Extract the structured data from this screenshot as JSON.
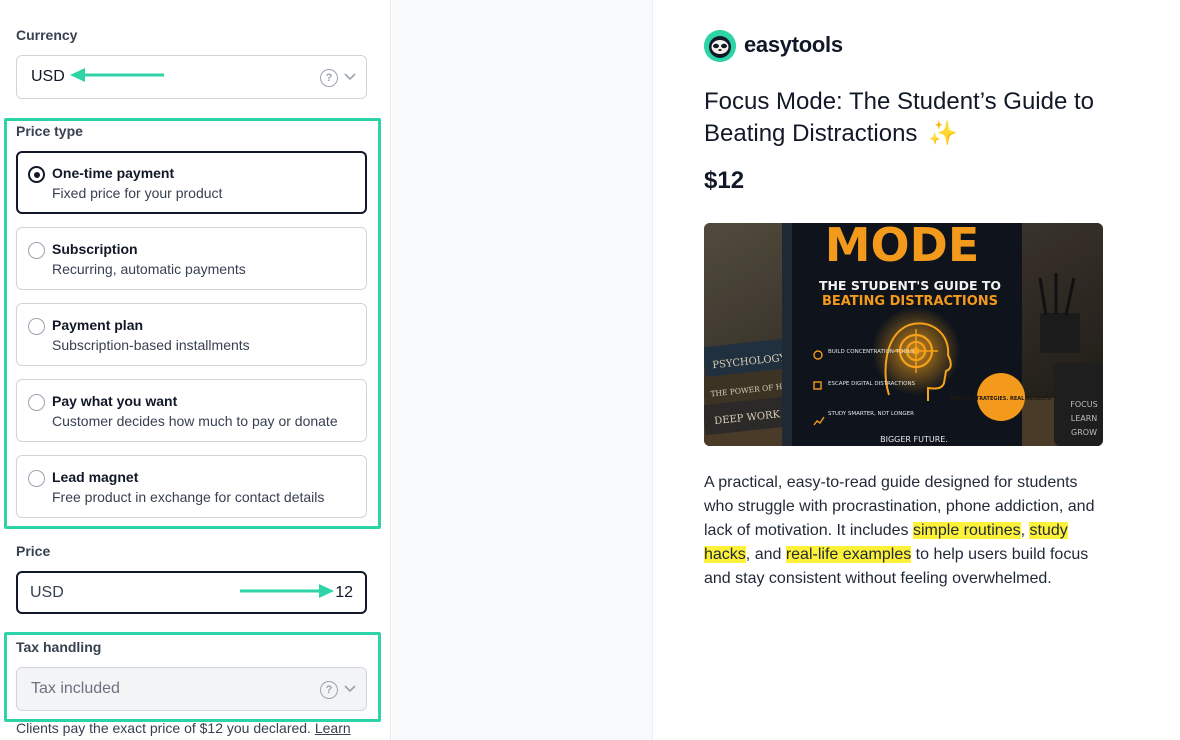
{
  "form": {
    "currency": {
      "label": "Currency",
      "value": "USD"
    },
    "price_type": {
      "label": "Price type",
      "options": [
        {
          "title": "One-time payment",
          "desc": "Fixed price for your product",
          "selected": true
        },
        {
          "title": "Subscription",
          "desc": "Recurring, automatic payments",
          "selected": false
        },
        {
          "title": "Payment plan",
          "desc": "Subscription-based installments",
          "selected": false
        },
        {
          "title": "Pay what you want",
          "desc": "Customer decides how much to pay or donate",
          "selected": false
        },
        {
          "title": "Lead magnet",
          "desc": "Free product in exchange for contact details",
          "selected": false
        }
      ]
    },
    "price": {
      "label": "Price",
      "currency": "USD",
      "amount": "12"
    },
    "tax": {
      "label": "Tax handling",
      "value": "Tax included"
    },
    "note": {
      "text": "Clients pay the exact price of $12 you declared.",
      "link": "Learn"
    }
  },
  "preview": {
    "brand": "easytools",
    "title": "Focus Mode: The Student’s Guide to Beating Distractions",
    "sparkle": "✨",
    "price": "$12",
    "cover": {
      "headline": "MODE",
      "subtitle_1": "THE STUDENT'S GUIDE TO",
      "subtitle_2": "BEATING DISTRACTIONS",
      "spines": [
        "PSYCHOLOGY",
        "THE POWER OF HABIT",
        "DEEP WORK"
      ],
      "bullets": [
        "BUILD CONCENTRATION TOOLS",
        "ESCAPE DIGITAL DISTRACTIONS",
        "STUDY SMARTER, NOT LONGER"
      ],
      "badge": "SIMPLE STRATEGIES. REAL RESULTS.",
      "mug": [
        "FOCUS",
        "LEARN",
        "GROW"
      ],
      "footer": "BIGGER FUTURE."
    },
    "description": {
      "p1": "A practical, easy-to-read guide designed for students who struggle with procrastination, phone addiction, and lack of motivation. It includes ",
      "h1": "simple routines",
      "p2": ", ",
      "h2": "study hacks",
      "p3": ", and ",
      "h3": "real-life examples",
      "p4": " to help users build focus and stay consistent without feeling overwhelmed."
    }
  },
  "colors": {
    "accent": "#2dd4a7",
    "highlight": "#fdf13a",
    "text": "#111827"
  }
}
